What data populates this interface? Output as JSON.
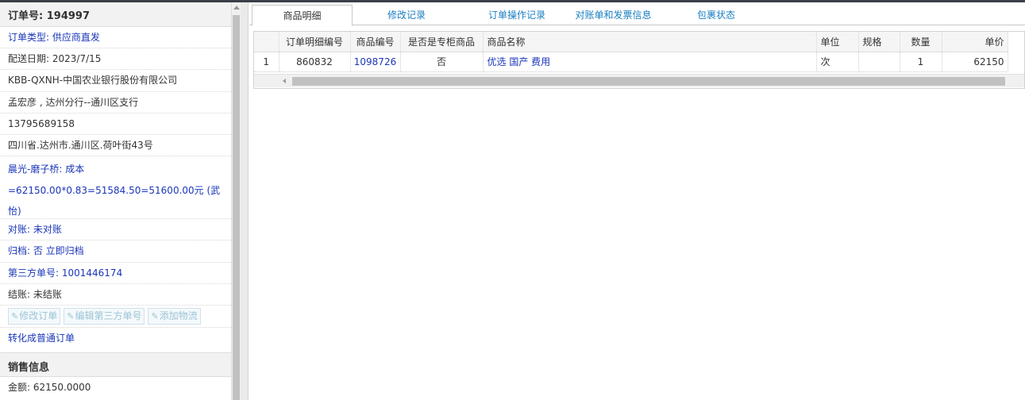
{
  "order": {
    "title": "订单号: 194997",
    "type": "订单类型: 供应商直发",
    "delivery_date": "配送日期: 2023/7/15",
    "customer": "KBB-QXNH-中国农业银行股份有限公司",
    "contact": "孟宏彦 , 达州分行--通川区支行",
    "phone": "13795689158",
    "address": "四川省.达州市.通川区.荷叶街43号",
    "cost_line1": "晨光-磨子桥: 成本",
    "cost_line2": "=62150.00*0.83=51584.50=51600.00元 (武",
    "cost_line3": "怡)",
    "reconcile": "对账: 未对账",
    "archive": "归档:  否 立即归档",
    "third_party_no": "第三方单号: 1001446174",
    "settlement": "结账: 未结账",
    "convert_link": "转化成普通订单"
  },
  "buttons": {
    "edit_order": "修改订单",
    "edit_third_party": "编辑第三方单号",
    "add_logistics": "添加物流"
  },
  "sales": {
    "title": "销售信息",
    "amount": "金额: 62150.0000"
  },
  "tabs": [
    {
      "label": "商品明细",
      "active": true
    },
    {
      "label": "修改记录",
      "active": false
    },
    {
      "label": "订单操作记录",
      "active": false
    },
    {
      "label": "对账单和发票信息",
      "active": false
    },
    {
      "label": "包裹状态",
      "active": false
    }
  ],
  "table": {
    "headers": [
      "",
      "订单明细编号",
      "商品编号",
      "是否是专柜商品",
      "商品名称",
      "单位",
      "规格",
      "数量",
      "单价"
    ],
    "rows": [
      [
        "1",
        "860832",
        "1098726",
        "否",
        "优选 国产 费用",
        "次",
        "",
        "1",
        "62150"
      ]
    ]
  },
  "colors": {
    "link_blue": "#1a36b8",
    "tab_blue": "#1a7fc1",
    "header_bg": "#f2f2f2"
  }
}
